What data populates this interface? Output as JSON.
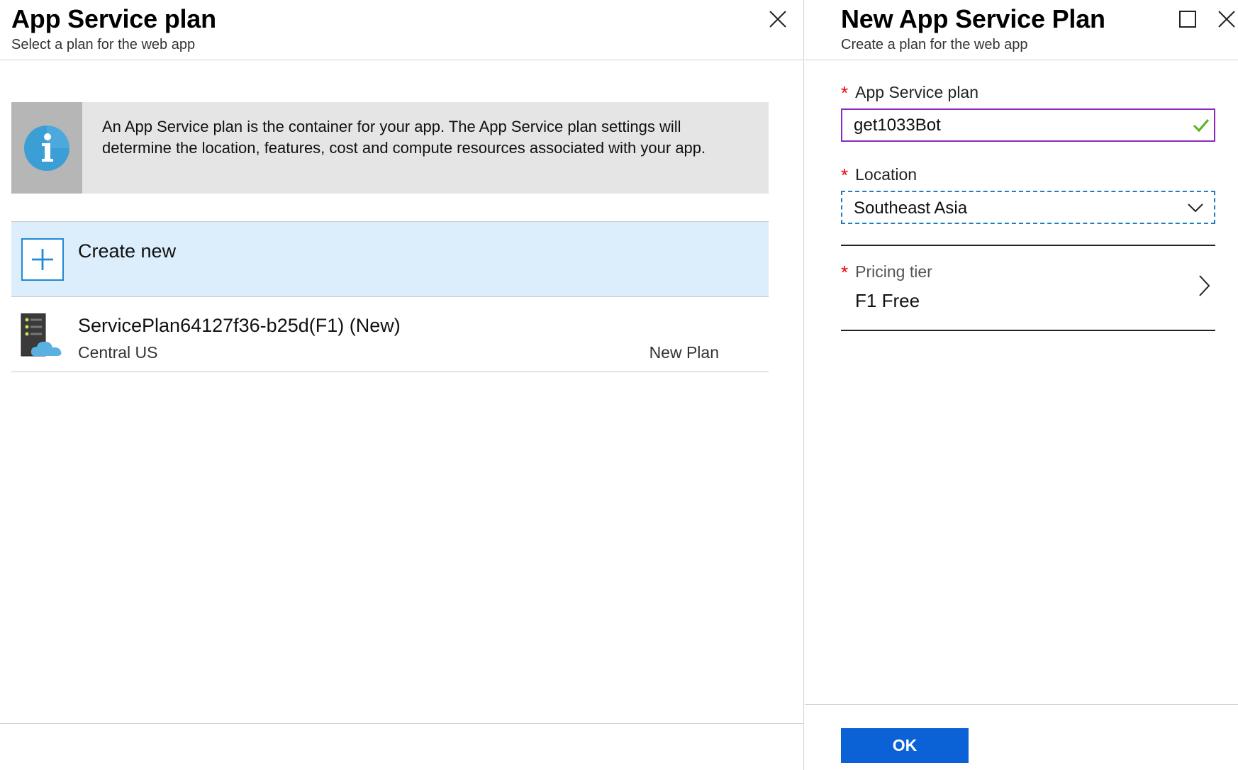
{
  "left_blade": {
    "title": "App Service plan",
    "subtitle": "Select a plan for the web app",
    "info_text": "An App Service plan is the container for your app. The App Service plan settings will determine the location, features, cost and compute resources associated with your app.",
    "create_new_label": "Create new",
    "plans": [
      {
        "name": "ServicePlan64127f36-b25d(F1) (New)",
        "location": "Central US",
        "badge": "New Plan"
      }
    ]
  },
  "right_blade": {
    "title": "New App Service Plan",
    "subtitle": "Create a plan for the web app",
    "required_marker": "*",
    "fields": {
      "plan_name": {
        "label": "App Service plan",
        "value": "get1033Bot"
      },
      "location": {
        "label": "Location",
        "value": "Southeast Asia"
      },
      "pricing_tier": {
        "label": "Pricing tier",
        "value": "F1 Free"
      }
    },
    "ok_label": "OK"
  },
  "colors": {
    "accent_blue": "#0b62d6",
    "create_row_bg": "#dcedfb",
    "input_border_valid": "#8b2ac3",
    "valid_check": "#5bb11e",
    "required_red": "#e00000",
    "info_box_bg": "#e5e5e5"
  },
  "icons": {
    "left_close": "close-icon",
    "right_maximize": "maximize-icon",
    "right_close": "close-icon",
    "info": "info-icon",
    "create": "plus-icon",
    "plan": "server-cloud-icon",
    "valid": "checkmark-icon",
    "dropdown": "chevron-down-icon",
    "navigate": "chevron-right-icon"
  }
}
